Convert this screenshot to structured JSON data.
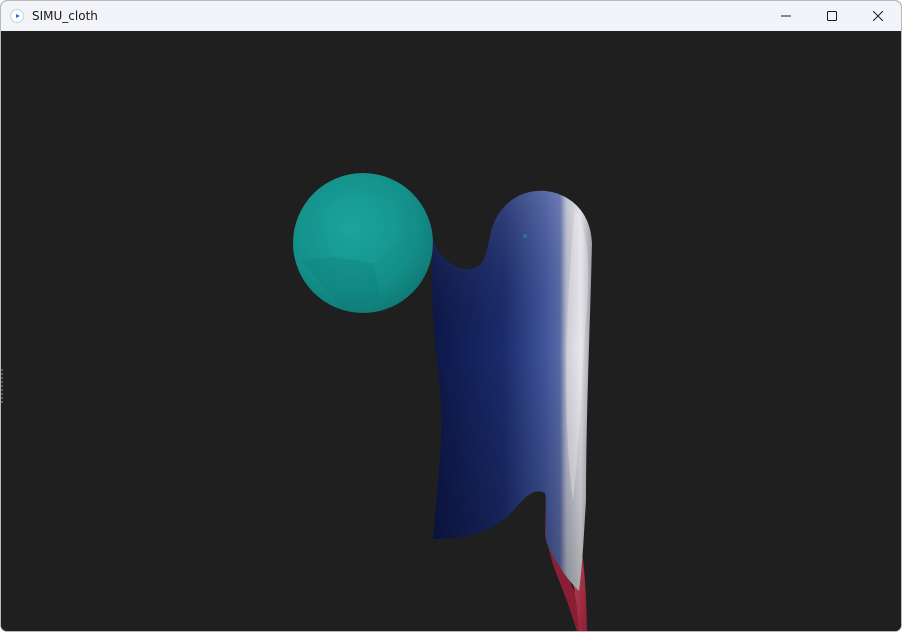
{
  "window": {
    "title": "SIMU_cloth",
    "app_icon": "app-play-icon",
    "controls": [
      "minimize-icon",
      "maximize-icon",
      "close-icon"
    ]
  },
  "scene": {
    "background": "#1f1f1f",
    "sphere_color": "#148f89",
    "cloth_colors": {
      "blue_dark": "#0f1a4f",
      "blue_light": "#4a5ea6",
      "white": "#e2e2e6",
      "red": "#b52b43"
    }
  }
}
